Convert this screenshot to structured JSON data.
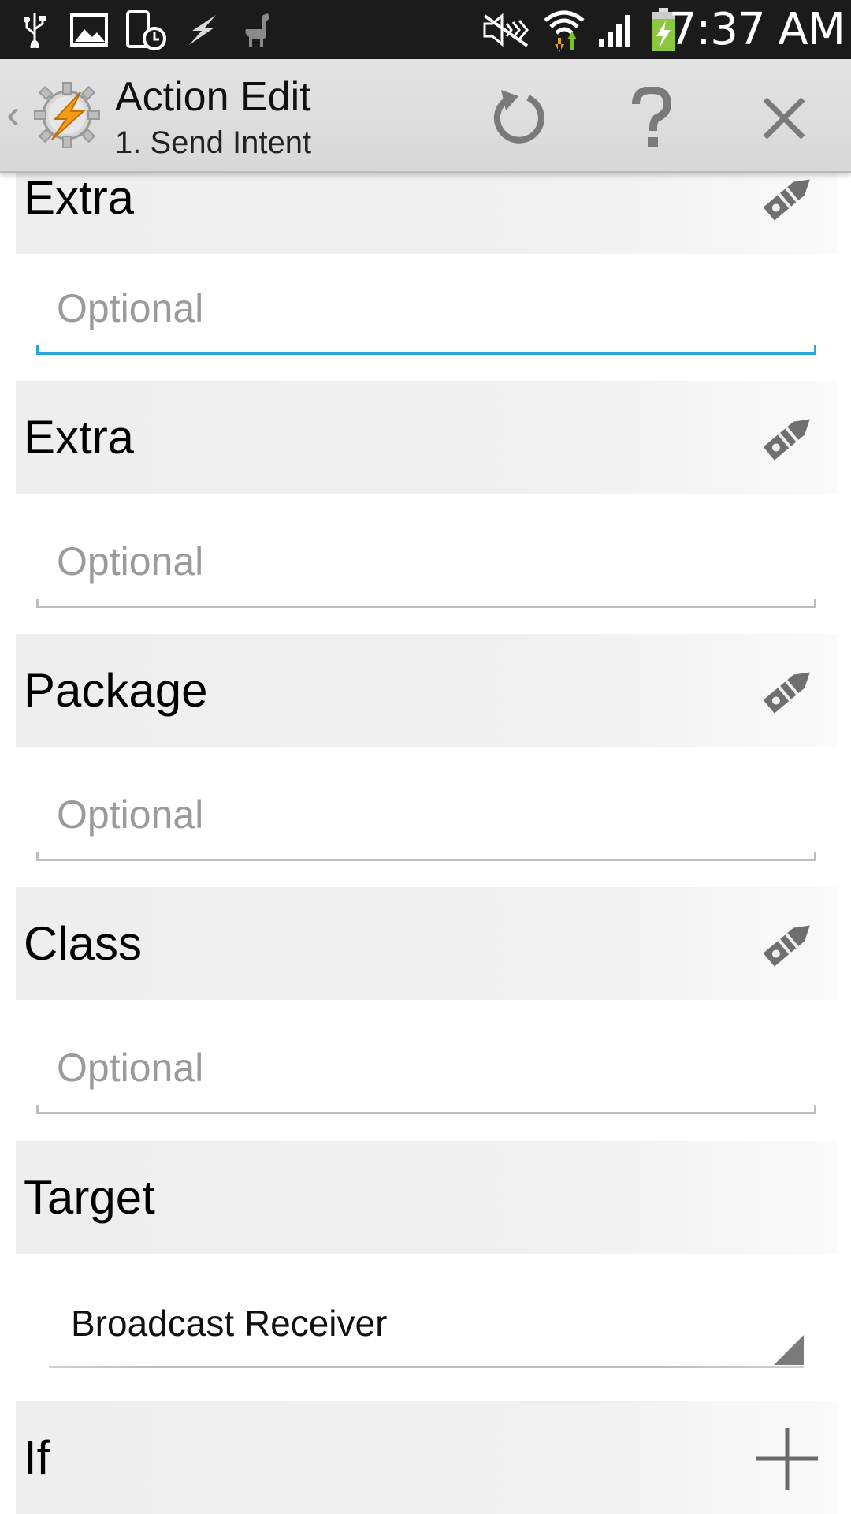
{
  "status_bar": {
    "time": "7:37 AM",
    "icons": [
      "usb-icon",
      "image-icon",
      "tablet-clock-icon",
      "bolt-icon",
      "llama-icon",
      "mute-icon",
      "wifi-icon",
      "signal-icon",
      "battery-charging-icon"
    ]
  },
  "action_bar": {
    "back_glyph": "‹",
    "title": "Action Edit",
    "subtitle": "1. Send Intent",
    "buttons": [
      "reset-icon",
      "help-icon",
      "close-icon"
    ]
  },
  "sections": {
    "extra1_label": "Extra",
    "extra1_placeholder": "Optional",
    "extra2_label": "Extra",
    "extra2_placeholder": "Optional",
    "package_label": "Package",
    "package_placeholder": "Optional",
    "class_label": "Class",
    "class_placeholder": "Optional",
    "target_label": "Target",
    "target_value": "Broadcast Receiver",
    "if_label": "If"
  },
  "colors": {
    "focus_accent": "#2aa7d9",
    "placeholder": "#9b9b9b",
    "status_bar_bg": "#1b1b1b",
    "action_bar_bg": "#dcdcdc"
  }
}
